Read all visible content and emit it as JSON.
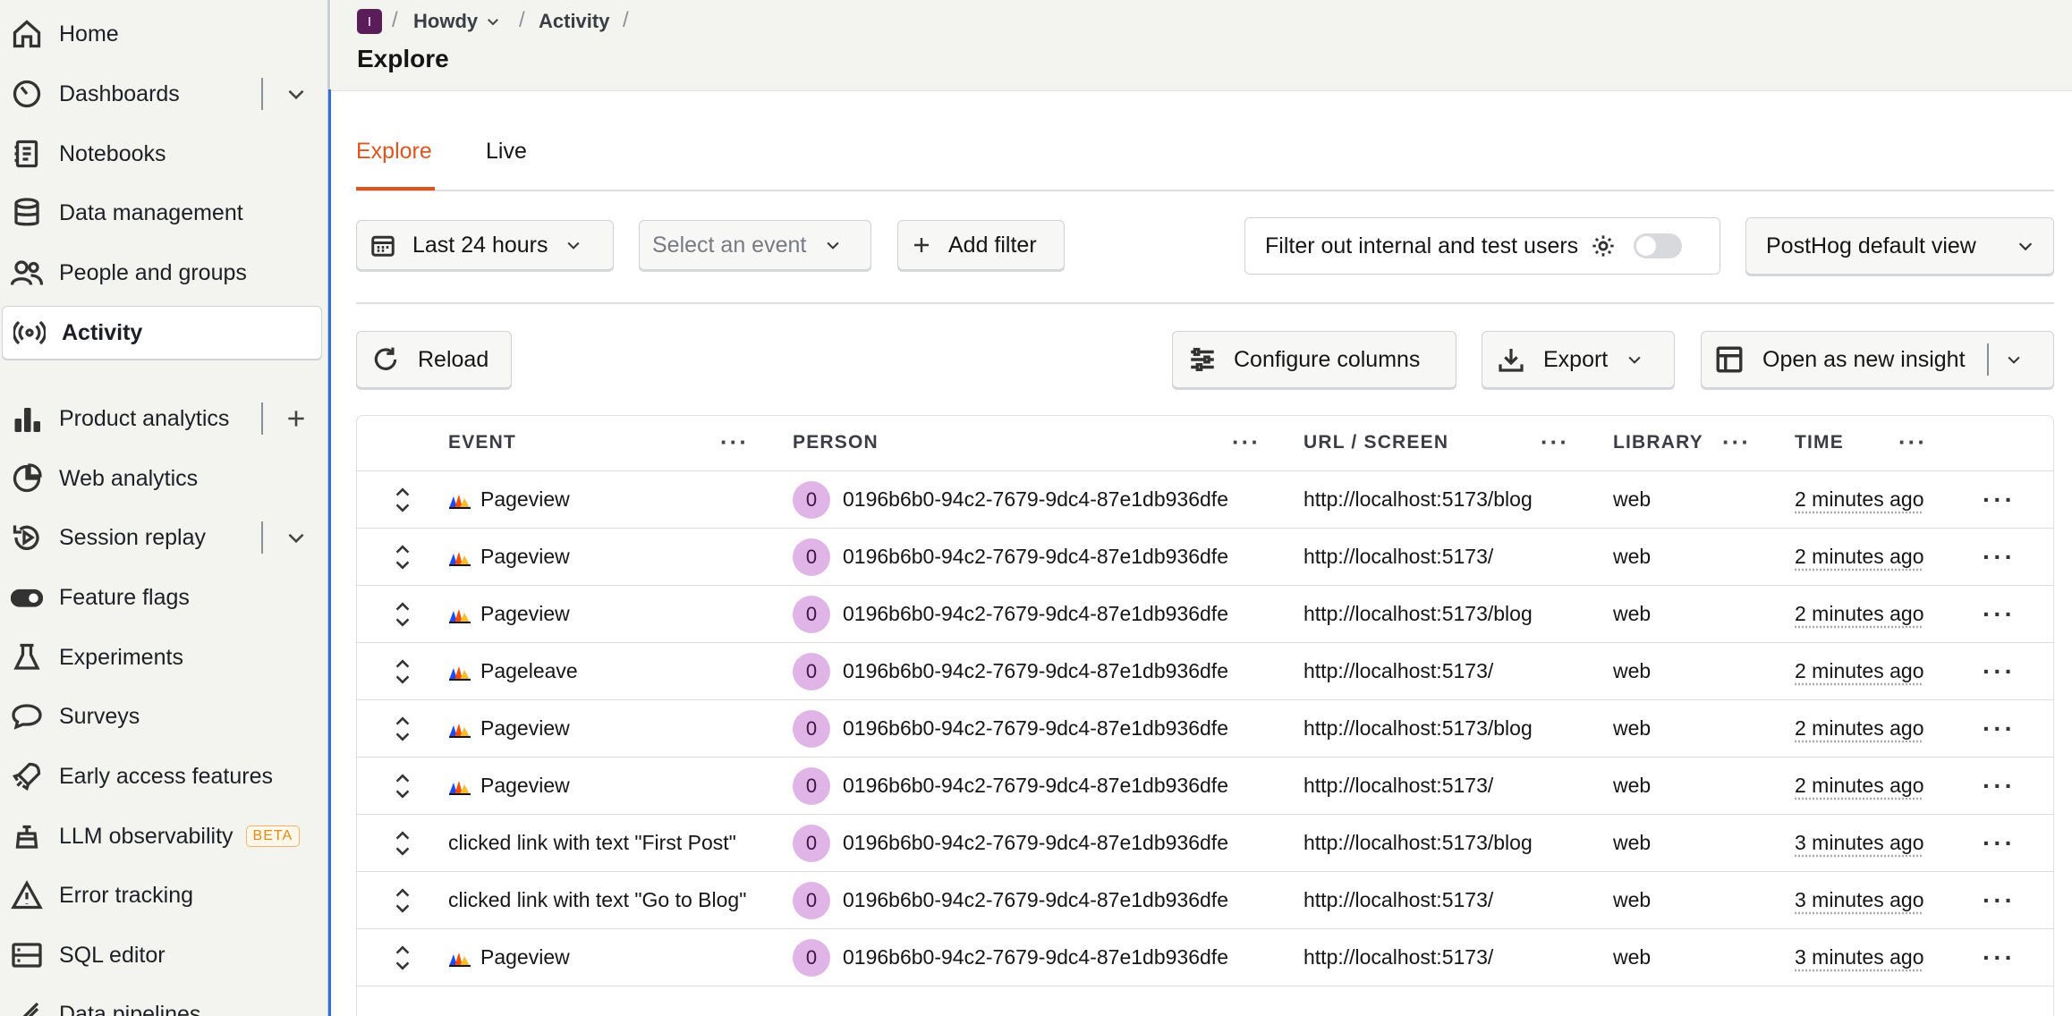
{
  "sidebar": {
    "items": [
      {
        "label": "Home",
        "icon": "home-icon"
      },
      {
        "label": "Dashboards",
        "icon": "gauge-icon"
      },
      {
        "label": "Notebooks",
        "icon": "notebook-icon"
      },
      {
        "label": "Data management",
        "icon": "database-icon"
      },
      {
        "label": "People and groups",
        "icon": "people-icon"
      },
      {
        "label": "Activity",
        "icon": "broadcast-icon"
      },
      {
        "label": "Product analytics",
        "icon": "bar-chart-icon"
      },
      {
        "label": "Web analytics",
        "icon": "pie-chart-icon"
      },
      {
        "label": "Session replay",
        "icon": "replay-icon"
      },
      {
        "label": "Feature flags",
        "icon": "toggle-icon"
      },
      {
        "label": "Experiments",
        "icon": "flask-icon"
      },
      {
        "label": "Surveys",
        "icon": "chat-icon"
      },
      {
        "label": "Early access features",
        "icon": "rocket-icon"
      },
      {
        "label": "LLM observability",
        "icon": "robot-icon",
        "badge": "BETA"
      },
      {
        "label": "Error tracking",
        "icon": "warning-icon"
      },
      {
        "label": "SQL editor",
        "icon": "server-icon"
      },
      {
        "label": "Data pipelines",
        "icon": "pipeline-icon"
      }
    ]
  },
  "header": {
    "project_initial": "I",
    "breadcrumb": [
      "Howdy",
      "Activity"
    ],
    "title": "Explore"
  },
  "tabs": [
    "Explore",
    "Live"
  ],
  "filters": {
    "date_range": "Last 24 hours",
    "event_placeholder": "Select an event",
    "add_filter": "Add filter",
    "internal_users": "Filter out internal and test users",
    "view": "PostHog default view"
  },
  "toolbar": {
    "reload": "Reload",
    "configure_columns": "Configure columns",
    "export": "Export",
    "open_insight": "Open as new insight"
  },
  "table": {
    "columns": [
      "EVENT",
      "PERSON",
      "URL / SCREEN",
      "LIBRARY",
      "TIME"
    ],
    "rows": [
      {
        "event": "Pageview",
        "icon": true,
        "person_initial": "0",
        "person": "0196b6b0-94c2-7679-9dc4-87e1db936dfe",
        "url": "http://localhost:5173/blog",
        "library": "web",
        "time": "2 minutes ago"
      },
      {
        "event": "Pageview",
        "icon": true,
        "person_initial": "0",
        "person": "0196b6b0-94c2-7679-9dc4-87e1db936dfe",
        "url": "http://localhost:5173/",
        "library": "web",
        "time": "2 minutes ago"
      },
      {
        "event": "Pageview",
        "icon": true,
        "person_initial": "0",
        "person": "0196b6b0-94c2-7679-9dc4-87e1db936dfe",
        "url": "http://localhost:5173/blog",
        "library": "web",
        "time": "2 minutes ago"
      },
      {
        "event": "Pageleave",
        "icon": true,
        "person_initial": "0",
        "person": "0196b6b0-94c2-7679-9dc4-87e1db936dfe",
        "url": "http://localhost:5173/",
        "library": "web",
        "time": "2 minutes ago"
      },
      {
        "event": "Pageview",
        "icon": true,
        "person_initial": "0",
        "person": "0196b6b0-94c2-7679-9dc4-87e1db936dfe",
        "url": "http://localhost:5173/blog",
        "library": "web",
        "time": "2 minutes ago"
      },
      {
        "event": "Pageview",
        "icon": true,
        "person_initial": "0",
        "person": "0196b6b0-94c2-7679-9dc4-87e1db936dfe",
        "url": "http://localhost:5173/",
        "library": "web",
        "time": "2 minutes ago"
      },
      {
        "event": "clicked link with text \"First Post\"",
        "icon": false,
        "person_initial": "0",
        "person": "0196b6b0-94c2-7679-9dc4-87e1db936dfe",
        "url": "http://localhost:5173/blog",
        "library": "web",
        "time": "3 minutes ago"
      },
      {
        "event": "clicked link with text \"Go to Blog\"",
        "icon": false,
        "person_initial": "0",
        "person": "0196b6b0-94c2-7679-9dc4-87e1db936dfe",
        "url": "http://localhost:5173/",
        "library": "web",
        "time": "3 minutes ago"
      },
      {
        "event": "Pageview",
        "icon": true,
        "person_initial": "0",
        "person": "0196b6b0-94c2-7679-9dc4-87e1db936dfe",
        "url": "http://localhost:5173/",
        "library": "web",
        "time": "3 minutes ago"
      }
    ]
  },
  "colors": {
    "accent": "#e0541e",
    "avatar": "#e0b4e6",
    "beta": "#e28b16"
  }
}
